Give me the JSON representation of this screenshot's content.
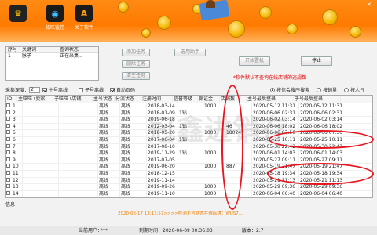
{
  "toolbar": {
    "items": [
      {
        "icon": "crown-icon",
        "label": ""
      },
      {
        "icon": "camera-icon",
        "label": "拓旺监控"
      },
      {
        "icon": "letter-a-icon",
        "label": "关于软件"
      }
    ]
  },
  "window": {
    "minimize": "—",
    "close": "✕"
  },
  "keyword_table": {
    "headers": [
      "序号",
      "关键词",
      "查询状态"
    ],
    "rows": [
      [
        "1",
        "脉子",
        "正在采集..."
      ]
    ]
  },
  "buttons": {
    "add_task": "添加任务",
    "delete_task": "删除任务",
    "clear_task": "清空任务",
    "use_helper": "选用助手",
    "start_collect": "开始置机",
    "stop": "停止"
  },
  "red_note": "*软件默认不查询在线店铺的违规数",
  "options": {
    "depth_label": "采集深度：",
    "depth_value": "2",
    "main_online": "主号离线",
    "sub_online": "子号离线",
    "auto_page": "自动页码",
    "sort_credit": "按信会搜序搜索",
    "sort_sales": "按销量",
    "sort_popularity": "按人气"
  },
  "grid": {
    "headers": [
      "ID",
      "主旺旺 (卖家)",
      "子旺旺 (店铺)",
      "主号状态",
      "分流状态",
      "注册时间",
      "信誉等级",
      "保证金",
      "店铺数",
      "主号最后登录",
      "子号最后登录"
    ],
    "rows": [
      [
        "1",
        "",
        "",
        "离线",
        "离线",
        "2018-03-14",
        "",
        "1000",
        "",
        "2020-05-12 11:31",
        "2020-05-12 11:31"
      ],
      [
        "2",
        "",
        "",
        "离线",
        "离线",
        "2018-01-09",
        "1钻",
        "",
        "",
        "2020-06-06 02:31",
        "2020-06-06 02:31"
      ],
      [
        "3",
        "",
        "",
        "离线",
        "离线",
        "2019-06-18",
        "",
        "",
        "",
        "2020-06-02 03:14",
        "2020-06-02 03:14"
      ],
      [
        "4",
        "",
        "",
        "离线",
        "离线",
        "2012-03-04",
        "1钻",
        "",
        "46",
        "2020-06-06 18:02",
        "2020-06-06 18:02"
      ],
      [
        "5",
        "",
        "",
        "离线",
        "离线",
        "2018-05-20",
        "",
        "1000",
        "18024",
        "2020-06-06 07:50",
        "2020-06-06 07:50"
      ],
      [
        "6",
        "",
        "",
        "离线",
        "离线",
        "2017-06-04",
        "1钻",
        "",
        "",
        "2020-05-25 10:11",
        "2020-05-25 10:11"
      ],
      [
        "7",
        "",
        "",
        "离线",
        "离线",
        "2017-08-10",
        "",
        "",
        "",
        "2020-05-30 22:42",
        "2020-05-30 22:42"
      ],
      [
        "8",
        "",
        "",
        "离线",
        "离线",
        "2019-11-29",
        "1钻",
        "1000",
        "",
        "2020-06-01 14:03",
        "2020-06-01 14:03"
      ],
      [
        "9",
        "",
        "",
        "离线",
        "离线",
        "2017-07-05",
        "",
        "",
        "",
        "2020-05-27 09:11",
        "2020-05-27 09:11"
      ],
      [
        "10",
        "",
        "",
        "离线",
        "离线",
        "2019-06-20",
        "",
        "1000",
        "887",
        "2020-05-19 21:47",
        "2020-05-19 21:47"
      ],
      [
        "11",
        "",
        "",
        "离线",
        "离线",
        "2018-12-15",
        "",
        "",
        "",
        "2020-05-18 19:34",
        "2020-05-18 19:34"
      ],
      [
        "12",
        "",
        "",
        "离线",
        "离线",
        "2019-11-14",
        "",
        "",
        "",
        "2020-05-21 11:13",
        "2020-05-21 11:13"
      ],
      [
        "13",
        "",
        "",
        "离线",
        "离线",
        "2019-09-26",
        "",
        "1000",
        "",
        "2020-05-29 09:36",
        "2020-05-29 09:36"
      ],
      [
        "14",
        "",
        "",
        "离线",
        "离线",
        "2019-11-10",
        "",
        "1000",
        "",
        "2020-06-04 06:40",
        "2020-06-04 06:40"
      ],
      [
        "15",
        "",
        "",
        "离线",
        "离线",
        "2019-12-24",
        "",
        "",
        "3969",
        "2020-06-06 07:37",
        "2020-06-06 07:37"
      ]
    ]
  },
  "watermark": "冠鑫进销存",
  "info_label": "信息：",
  "log_line": "2020-06-17 13:13:57>>>>检测主号状态在线店铺：WUS7...",
  "status": {
    "user": "当前用户：",
    "user_value": "***",
    "expire": "到期时间：2020-06-09 00:36:03",
    "version": "版本：2.7"
  },
  "colors": {
    "accent": "#ff7a00",
    "highlight": "#e8141e"
  }
}
